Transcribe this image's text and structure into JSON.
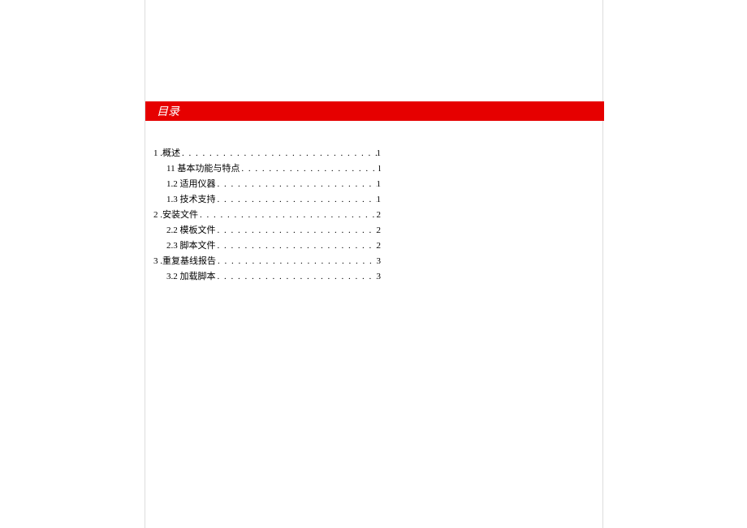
{
  "header": {
    "title": "目录"
  },
  "toc": {
    "dots": ". . . . . . . . . . . . . . . . . . . . . . . . . . . . . . . . . . . . . . . . . . . . . . . . . . . . . . . . . . . .",
    "entries": [
      {
        "level": 1,
        "label": "1  .概述",
        "page": "1"
      },
      {
        "level": 2,
        "label": "11 基本功能与特点",
        "page": "l"
      },
      {
        "level": 2,
        "label": "1.2    适用仪器",
        "page": "1"
      },
      {
        "level": 2,
        "label": "1.3    技术支持",
        "page": "1"
      },
      {
        "level": 1,
        "label": "2    .安装文件",
        "page": "2"
      },
      {
        "level": 2,
        "label": "2.2    模板文件",
        "page": "2"
      },
      {
        "level": 2,
        "label": "2.3    脚本文件",
        "page": "2"
      },
      {
        "level": 1,
        "label": "3    .重复基线报告",
        "page": "3"
      },
      {
        "level": 2,
        "label": "3.2    加载脚本",
        "page": "3"
      }
    ]
  }
}
